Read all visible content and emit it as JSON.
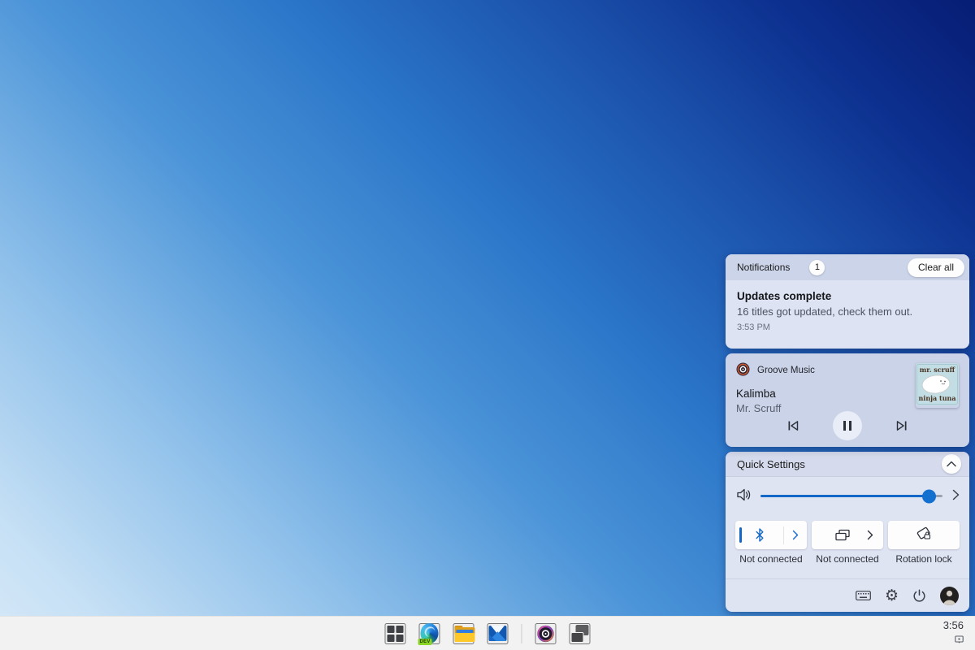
{
  "colors": {
    "accent": "#1368c8",
    "wallpaper_dark": "#071d74",
    "wallpaper_light": "#d6e9f8",
    "taskbar_bg": "#f2f2f3"
  },
  "notifications": {
    "title": "Notifications",
    "badge_count": "1",
    "clear_all_label": "Clear all",
    "items": [
      {
        "title": "Updates complete",
        "message": "16 titles got updated, check them out.",
        "time": "3:53 PM"
      }
    ]
  },
  "media_player": {
    "app_name": "Groove Music",
    "track_title": "Kalimba",
    "artist": "Mr. Scruff",
    "album_art": {
      "top_text": "mr. scruff",
      "bottom_text": "ninja tuna"
    },
    "controls": [
      "previous",
      "pause",
      "next"
    ]
  },
  "quick_settings": {
    "title": "Quick Settings",
    "volume_percent": 93,
    "tiles": [
      {
        "name": "bluetooth",
        "label": "Not connected"
      },
      {
        "name": "connect",
        "label": "Not connected"
      },
      {
        "name": "rotation-lock",
        "label": "Rotation lock"
      }
    ]
  },
  "taskbar": {
    "time": "3:56",
    "edge_badge": "DEV",
    "icons": [
      "start",
      "edge-dev",
      "file-explorer",
      "mail",
      "groove-music",
      "task-view"
    ]
  }
}
